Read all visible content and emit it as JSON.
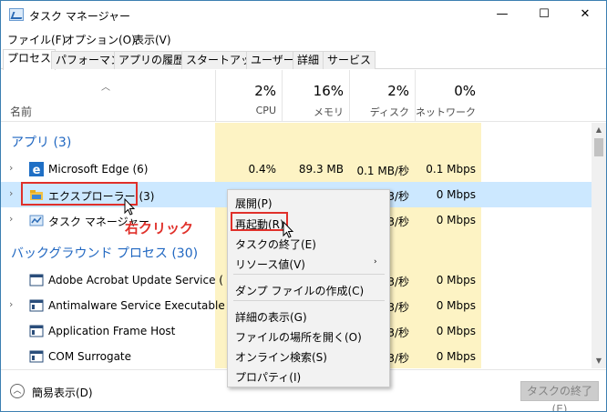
{
  "window": {
    "title": "タスク マネージャー",
    "controls": {
      "minimize": "—",
      "maximize": "☐",
      "close": "✕"
    }
  },
  "menu": [
    "ファイル(F)",
    "オプション(O)",
    "表示(V)"
  ],
  "tabs": [
    "プロセス",
    "パフォーマンス",
    "アプリの履歴",
    "スタートアップ",
    "ユーザー",
    "詳細",
    "サービス"
  ],
  "columns": {
    "name_label": "名前",
    "cpu": {
      "pct": "2%",
      "label": "CPU"
    },
    "memory": {
      "pct": "16%",
      "label": "メモリ"
    },
    "disk": {
      "pct": "2%",
      "label": "ディスク"
    },
    "network": {
      "pct": "0%",
      "label": "ネットワーク"
    }
  },
  "sections": {
    "apps": "アプリ (3)",
    "background": "バックグラウンド プロセス (30)"
  },
  "app_rows": [
    {
      "name": "Microsoft Edge (6)",
      "cpu": "0.4%",
      "memory": "89.3 MB",
      "disk": "0.1 MB/秒",
      "network": "0.1 Mbps",
      "icon": "edge-icon"
    },
    {
      "name": "エクスプローラー (3)",
      "cpu": "",
      "memory": "",
      "disk": "3/秒",
      "network": "0 Mbps",
      "icon": "explorer-folder-icon"
    },
    {
      "name": "タスク マネージャー",
      "cpu": "",
      "memory": "",
      "disk": "3/秒",
      "network": "0 Mbps",
      "icon": "task-manager-icon"
    }
  ],
  "bg_rows": [
    {
      "name": "Adobe Acrobat Update Service (",
      "disk": "3/秒",
      "network": "0 Mbps",
      "icon": "window-icon"
    },
    {
      "name": "Antimalware Service Executable",
      "disk": "3/秒",
      "network": "0 Mbps",
      "icon": "window-icon"
    },
    {
      "name": "Application Frame Host",
      "disk": "3/秒",
      "network": "0 Mbps",
      "icon": "window-icon"
    },
    {
      "name": "COM Surrogate",
      "disk": "3/秒",
      "network": "0 Mbps",
      "icon": "window-icon"
    }
  ],
  "context_menu": {
    "expand": "展開(P)",
    "restart": "再起動(R)",
    "end_task": "タスクの終了(E)",
    "resource_values": "リソース値(V)",
    "dump": "ダンプ ファイルの作成(C)",
    "details": "詳細の表示(G)",
    "open_location": "ファイルの場所を開く(O)",
    "search_online": "オンライン検索(S)",
    "properties": "プロパティ(I)"
  },
  "annotation": "右クリック",
  "footer": {
    "fewer_details": "簡易表示(D)",
    "end_task_button": "タスクの終了(E)"
  },
  "colors": {
    "accent": "#2067c1",
    "highlight_column": "#fdf3c4",
    "selected_row": "#cce8ff",
    "annotation_red": "#e0302a"
  }
}
